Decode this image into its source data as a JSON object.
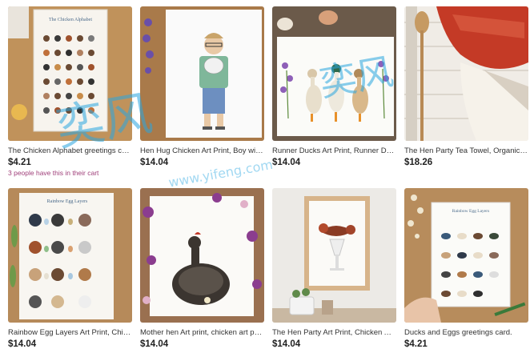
{
  "products": [
    {
      "title": "The Chicken Alphabet greetings card, ...",
      "price": "$4.21",
      "cart_note": "3 people have this in their cart",
      "image": "chicken-alphabet-card",
      "card_title": "The Chicken Alphabet"
    },
    {
      "title": "Hen Hug Chicken Art Print, Boy with p...",
      "price": "$14.04",
      "image": "boy-hugging-hen-print"
    },
    {
      "title": "Runner Ducks Art Print, Runner Ducks i...",
      "price": "$14.04",
      "image": "runner-ducks-print"
    },
    {
      "title": "The Hen Party Tea Towel, Organic Cott...",
      "price": "$18.26",
      "image": "hen-party-tea-towel"
    },
    {
      "title": "Rainbow Egg Layers Art Print, Chicken ...",
      "price": "$14.04",
      "image": "rainbow-egg-layers-print",
      "card_title": "Rainbow Egg Layers"
    },
    {
      "title": "Mother hen Art print, chicken art print,...",
      "price": "$14.04",
      "image": "mother-hen-print"
    },
    {
      "title": "The Hen Party Art Print, Chicken Art Pr...",
      "price": "$14.04",
      "image": "hen-party-framed-print"
    },
    {
      "title": "Ducks and Eggs greetings card.",
      "price": "$4.21",
      "image": "ducks-and-eggs-card",
      "card_title": "Rainbow Egg Layers"
    }
  ],
  "watermark": {
    "text": "奕风",
    "url_text": "www.yifeng.com"
  },
  "colors": {
    "watermark": "#2aa6e0",
    "price": "#222222",
    "cart_note": "#a0407a"
  }
}
